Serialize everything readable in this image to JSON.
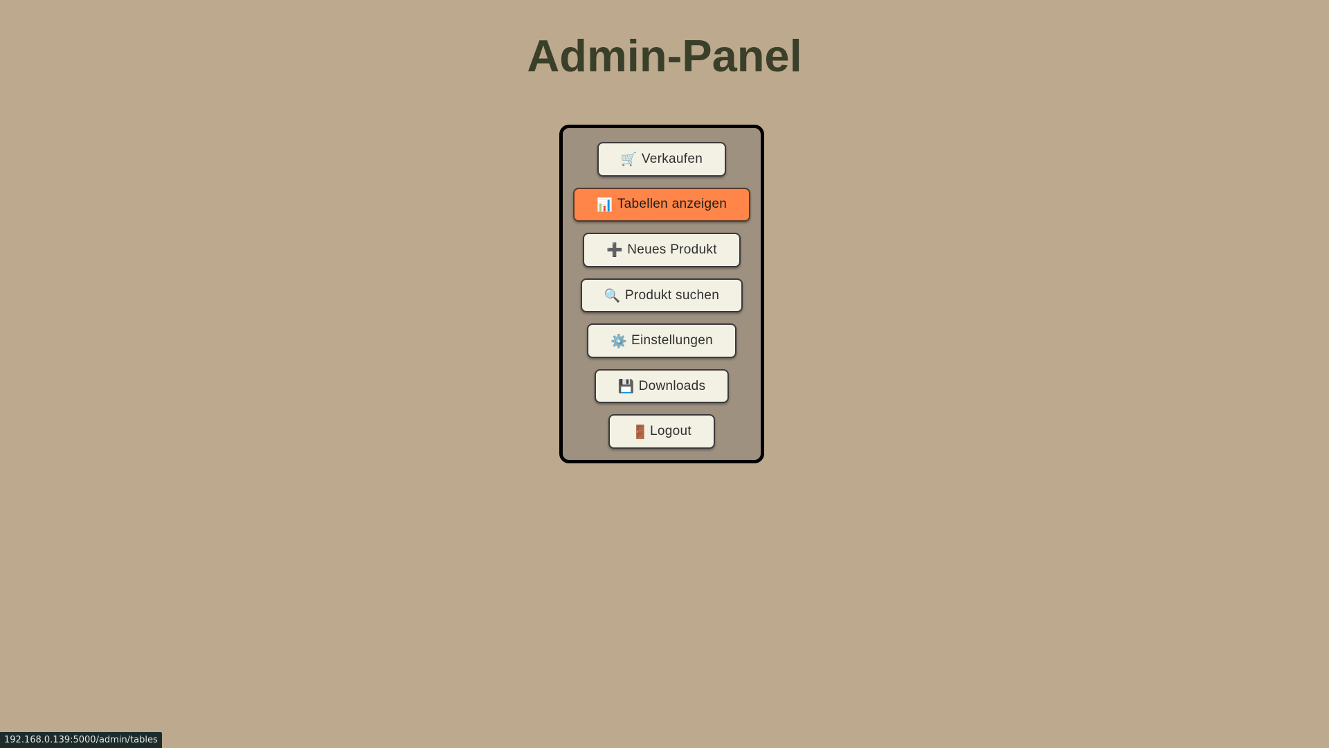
{
  "title": "Admin-Panel",
  "menu": [
    {
      "icon": "🛒",
      "icon_name": "shopping-cart-icon",
      "label": "Verkaufen",
      "active": false
    },
    {
      "icon": "📊",
      "icon_name": "bar-chart-icon",
      "label": "Tabellen anzeigen",
      "active": true
    },
    {
      "icon": "➕",
      "icon_name": "plus-icon",
      "label": "Neues Produkt",
      "active": false
    },
    {
      "icon": "🔍",
      "icon_name": "magnifier-icon",
      "label": "Produkt suchen",
      "active": false
    },
    {
      "icon": "⚙️",
      "icon_name": "gear-icon",
      "label": "Einstellungen",
      "active": false
    },
    {
      "icon": "💾",
      "icon_name": "floppy-disk-icon",
      "label": "Downloads",
      "active": false
    },
    {
      "icon": "🚪",
      "icon_name": "door-icon",
      "label": "Logout",
      "active": false
    }
  ],
  "status_url": "192.168.0.139:5000/admin/tables",
  "colors": {
    "background": "#bda98d",
    "panel": "#9e9180",
    "active_button": "#ff8548",
    "button": "#f2f1e4",
    "title": "#3a3f29"
  }
}
